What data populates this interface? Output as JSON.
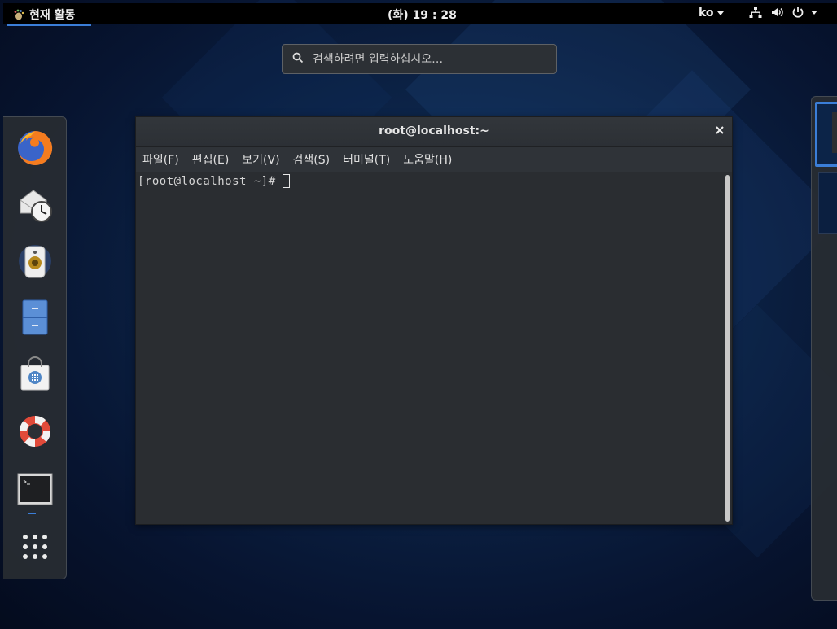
{
  "topbar": {
    "activities_label": "현재 활동",
    "clock": "(화) 19 : 28",
    "language": "ko",
    "tray_icons": [
      "network-icon",
      "volume-icon",
      "power-icon"
    ]
  },
  "search": {
    "placeholder": "검색하려면 입력하십시오…"
  },
  "dash": {
    "apps": [
      {
        "name": "firefox",
        "icon": "firefox-icon"
      },
      {
        "name": "evolution",
        "icon": "mail-clock-icon"
      },
      {
        "name": "rhythmbox",
        "icon": "speaker-icon"
      },
      {
        "name": "files",
        "icon": "file-cabinet-icon"
      },
      {
        "name": "software",
        "icon": "shopping-bag-icon"
      },
      {
        "name": "help",
        "icon": "lifebuoy-icon"
      },
      {
        "name": "terminal",
        "icon": "terminal-icon",
        "running": true
      },
      {
        "name": "show-applications",
        "icon": "app-grid-icon"
      }
    ]
  },
  "terminal": {
    "title": "root@localhost:~",
    "menu": [
      "파일(F)",
      "편집(E)",
      "보기(V)",
      "검색(S)",
      "터미널(T)",
      "도움말(H)"
    ],
    "prompt": "[root@localhost ~]# "
  },
  "colors": {
    "accent": "#3b7ed8",
    "topbar_bg": "#000000",
    "terminal_bg": "#2a2d31"
  }
}
